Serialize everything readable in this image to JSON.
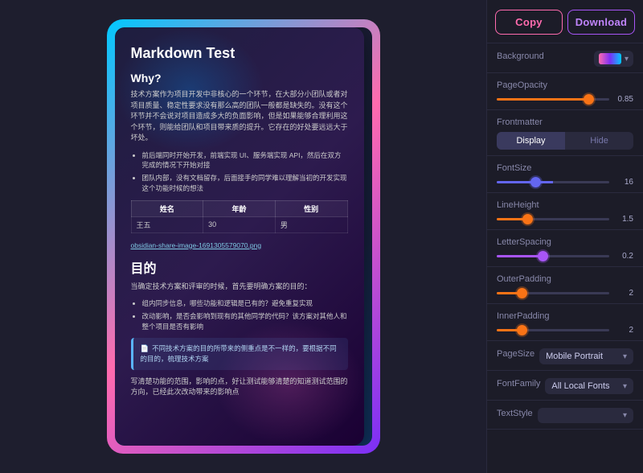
{
  "toolbar": {
    "copy_label": "Copy",
    "download_label": "Download"
  },
  "preview": {
    "title": "Markdown Test",
    "section1_heading": "Why?",
    "section1_body": "技术方案作为项目开发中非核心的一个环节，在大部分小团队或者对项目质量、稳定性要求没有那么高的团队一般都是缺失的。没有这个环节并不会说对项目造成多大的负面影响，但是如果能够合理利用这个环节，则能给团队和项目带来质的提升。它存在的好处要远远大于坏处。",
    "bullet1_1": "前后端同时开始开发，前端实现 UI、服务端实现 API，然后在双方完成的情况下开始对接",
    "bullet1_2": "团队内部，没有文档留存，后面接手的同学难以理解当初的开发实现这个功能时候的想法",
    "table_headers": [
      "姓名",
      "年龄",
      "性别"
    ],
    "table_row": [
      "王五",
      "30",
      "男"
    ],
    "link_text": "obsidian-share-image-1691305579070.png",
    "section2_heading": "目的",
    "section2_body": "当确定技术方案和评审的时候，首先要明确方案的目的：",
    "bullet2_1": "组内同步信息，哪些功能和逻辑是已有的？避免重复实现",
    "bullet2_2": "改动影响，是否会影响到现有的其他同学的代码？该方案对其他人和整个项目是否有影响",
    "callout_text": "不同技术方案的目的所带来的侧重点是不一样的，要根据不同的目的，梳理技术方案",
    "section3_body": "写清楚功能的范围，影响的点，好让测试能够清楚的知道测试范围的方向，已经此次改动带来的影响点"
  },
  "panel": {
    "background_label": "Background",
    "page_opacity_label": "PageOpacity",
    "page_opacity_value": "0.85",
    "frontmatter_label": "Frontmatter",
    "display_label": "Display",
    "hide_label": "Hide",
    "font_size_label": "FontSize",
    "font_size_value": "16",
    "line_height_label": "LineHeight",
    "line_height_value": "1.5",
    "letter_spacing_label": "LetterSpacing",
    "letter_spacing_value": "0.2",
    "outer_padding_label": "OuterPadding",
    "outer_padding_value": "2",
    "inner_padding_label": "InnerPadding",
    "inner_padding_value": "2",
    "page_size_label": "PageSize",
    "page_size_value": "Mobile Portrait",
    "font_family_label": "FontFamily",
    "font_family_value": "All Local Fonts",
    "text_style_label": "TextStyle"
  }
}
